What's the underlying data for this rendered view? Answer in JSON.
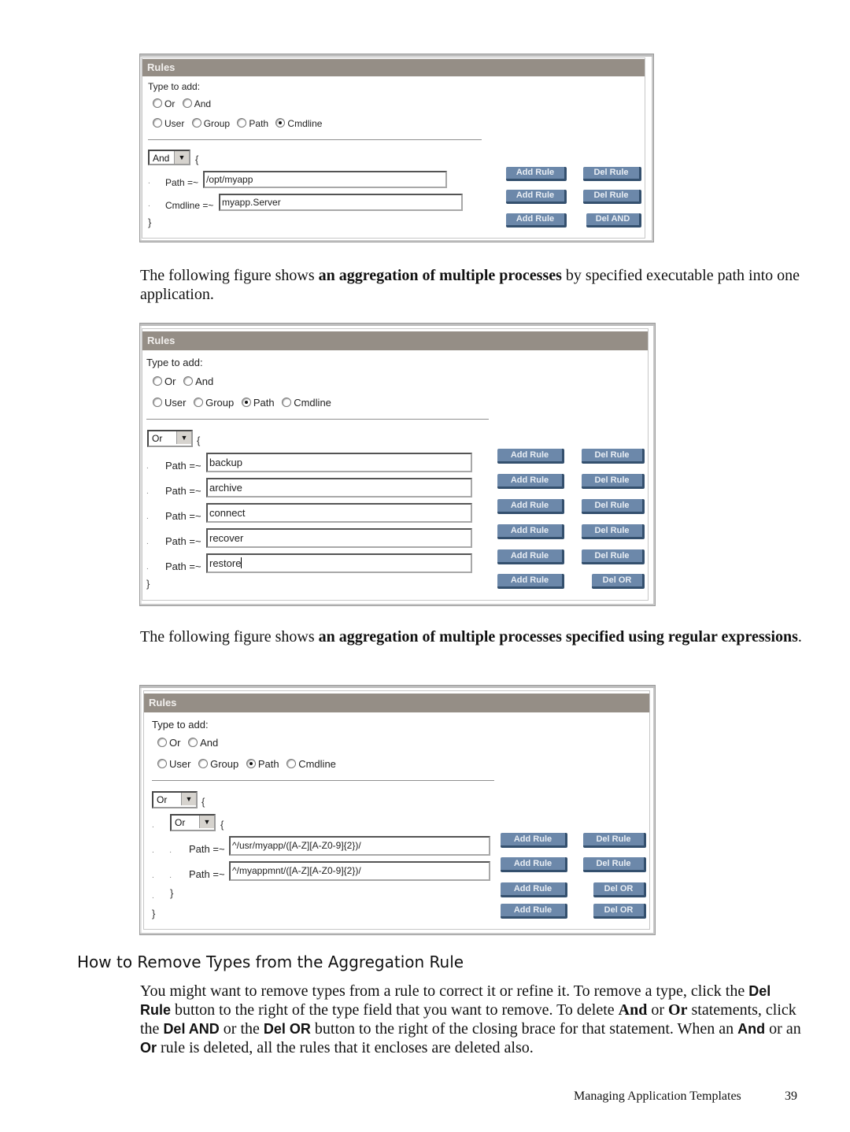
{
  "figure1": {
    "title": "Rules",
    "type_to_add": "Type to add:",
    "logic_options": [
      {
        "label": "Or",
        "checked": false
      },
      {
        "label": "And",
        "checked": false
      }
    ],
    "type_options": [
      {
        "label": "User",
        "checked": false
      },
      {
        "label": "Group",
        "checked": false
      },
      {
        "label": "Path",
        "checked": false
      },
      {
        "label": "Cmdline",
        "checked": true
      }
    ],
    "operator": "And",
    "open_brace": "{",
    "close_brace": "}",
    "rules": [
      {
        "label": "Path =~",
        "value": "/opt/myapp"
      },
      {
        "label": "Cmdline =~",
        "value": "myapp.Server"
      }
    ],
    "add_rule": "Add Rule",
    "del_rule": "Del Rule",
    "del_group": "Del AND"
  },
  "para1": {
    "before": "The following figure shows ",
    "bold": "an aggregation of multiple processes",
    "after": " by specified executable path into one application."
  },
  "figure2": {
    "title": "Rules",
    "type_to_add": "Type to add:",
    "logic_options": [
      {
        "label": "Or",
        "checked": false
      },
      {
        "label": "And",
        "checked": false
      }
    ],
    "type_options": [
      {
        "label": "User",
        "checked": false
      },
      {
        "label": "Group",
        "checked": false
      },
      {
        "label": "Path",
        "checked": true
      },
      {
        "label": "Cmdline",
        "checked": false
      }
    ],
    "operator": "Or",
    "open_brace": "{",
    "close_brace": "}",
    "rules": [
      {
        "label": "Path =~",
        "value": "backup"
      },
      {
        "label": "Path =~",
        "value": "archive"
      },
      {
        "label": "Path =~",
        "value": "connect"
      },
      {
        "label": "Path =~",
        "value": "recover"
      },
      {
        "label": "Path =~",
        "value": "restore"
      }
    ],
    "add_rule": "Add Rule",
    "del_rule": "Del Rule",
    "del_group": "Del OR"
  },
  "para2": {
    "before": "The following figure shows ",
    "bold": "an aggregation of multiple processes specified using regular expressions",
    "after": "."
  },
  "figure3": {
    "title": "Rules",
    "type_to_add": "Type to add:",
    "logic_options": [
      {
        "label": "Or",
        "checked": false
      },
      {
        "label": "And",
        "checked": false
      }
    ],
    "type_options": [
      {
        "label": "User",
        "checked": false
      },
      {
        "label": "Group",
        "checked": false
      },
      {
        "label": "Path",
        "checked": true
      },
      {
        "label": "Cmdline",
        "checked": false
      }
    ],
    "operator": "Or",
    "inner_operator": "Or",
    "open_brace": "{",
    "close_brace": "}",
    "rules": [
      {
        "label": "Path =~",
        "value": "^/usr/myapp/([A-Z][A-Z0-9]{2})/"
      },
      {
        "label": "Path =~",
        "value": "^/myappmnt/([A-Z][A-Z0-9]{2})/"
      }
    ],
    "add_rule": "Add Rule",
    "del_rule": "Del Rule",
    "del_group": "Del OR"
  },
  "section": {
    "heading": "How to Remove Types from the Aggregation Rule",
    "t1": "You might want to remove types from a rule to correct it or refine it. To remove a type, click the ",
    "b1": "Del Rule",
    "t2": " button to the right of the type field that you want to remove. To delete ",
    "b2": "And",
    "t3": " or ",
    "b3": "Or",
    "t4": " statements, click the ",
    "b4": "Del AND",
    "t5": " or the ",
    "b5": "Del OR",
    "t6": " button to the right of the closing brace for that statement. When an ",
    "b6": "And",
    "t7": " or an ",
    "b7": "Or",
    "t8": " rule is deleted, all the rules that it encloses are deleted also."
  },
  "footer": {
    "chapter": "Managing Application Templates",
    "page": "39"
  }
}
